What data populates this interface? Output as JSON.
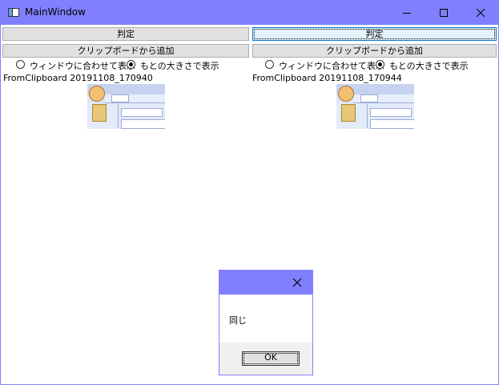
{
  "window": {
    "title": "MainWindow",
    "accent_color": "#8080ff"
  },
  "panels": [
    {
      "judge_label": "判定",
      "add_label": "クリップボードから追加",
      "radio_fit_label": "ウィンドウに合わせて表示",
      "radio_orig_label": "もとの大きさで表示",
      "selected_radio": "もとの大きさで表示",
      "file_name": "FromClipboard 20191108_170940"
    },
    {
      "judge_label": "判定",
      "add_label": "クリップボードから追加",
      "radio_fit_label": "ウィンドウに合わせて表示",
      "radio_orig_label": "もとの大きさで表示",
      "selected_radio": "もとの大きさで表示",
      "file_name": "FromClipboard 20191108_170944"
    }
  ],
  "dialog": {
    "message": "同じ",
    "ok_label": "OK"
  }
}
